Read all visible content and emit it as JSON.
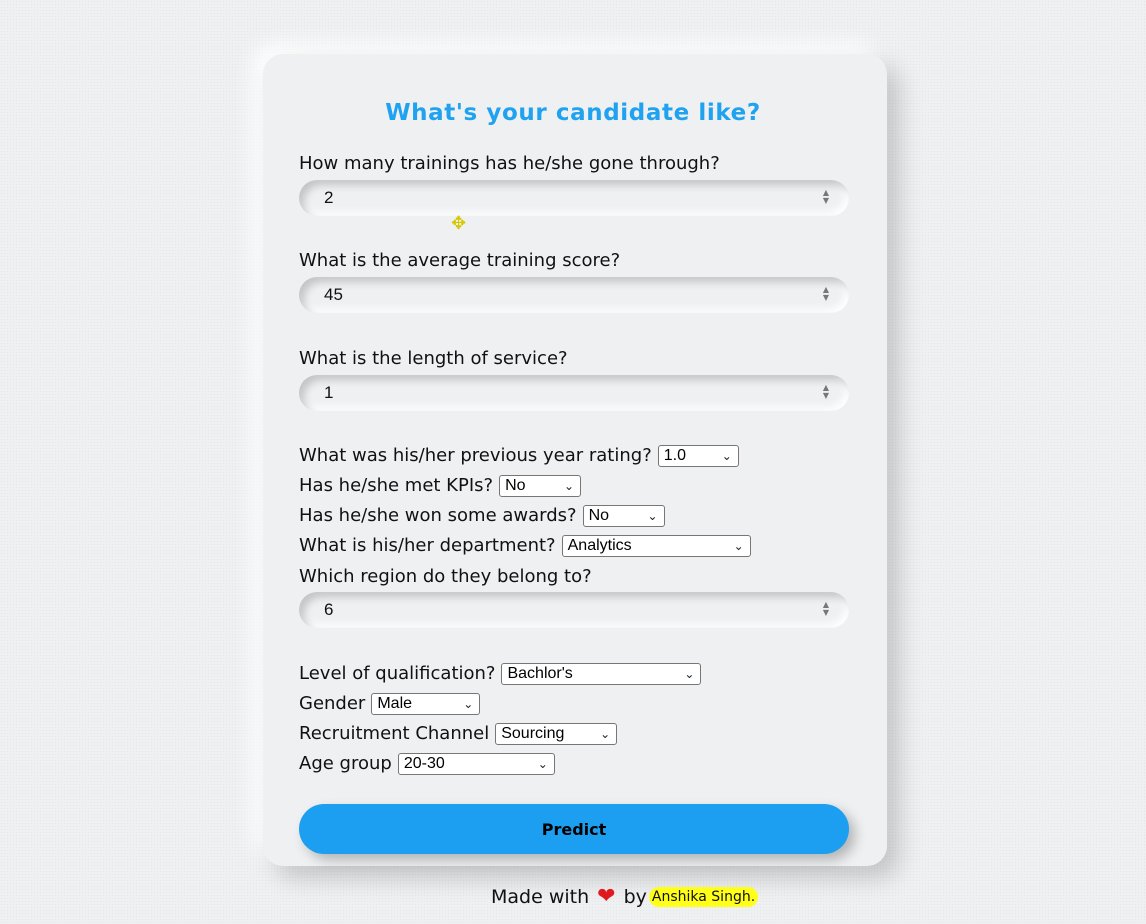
{
  "form": {
    "title": "What's your candidate like?",
    "trainings": {
      "label": "How many trainings has he/she gone through?",
      "value": "2"
    },
    "avg_score": {
      "label": "What is the average training score?",
      "value": "45"
    },
    "service": {
      "label": "What is the length of service?",
      "value": "1"
    },
    "rating": {
      "label": "What was his/her previous year rating?",
      "selected": "1.0"
    },
    "kpis": {
      "label": "Has he/she met KPIs?",
      "selected": "No"
    },
    "awards": {
      "label": "Has he/she won some awards?",
      "selected": "No"
    },
    "department": {
      "label": "What is his/her department?",
      "selected": "Analytics"
    },
    "region": {
      "label": "Which region do they belong to?",
      "value": "6"
    },
    "qualification": {
      "label": "Level of qualification?",
      "selected": "Bachlor's"
    },
    "gender": {
      "label": "Gender",
      "selected": "Male"
    },
    "channel": {
      "label": "Recruitment Channel",
      "selected": "Sourcing"
    },
    "age": {
      "label": "Age group",
      "selected": "20-30"
    },
    "predict_label": "Predict"
  },
  "footer": {
    "made_with": "Made with",
    "heart_icon": "heart-icon",
    "by": "by",
    "author": "Anshika Singh."
  },
  "colors": {
    "accent": "#1fa2ef",
    "button": "#1c9ff0",
    "highlight": "#ffff1a",
    "heart": "#e0191f"
  }
}
